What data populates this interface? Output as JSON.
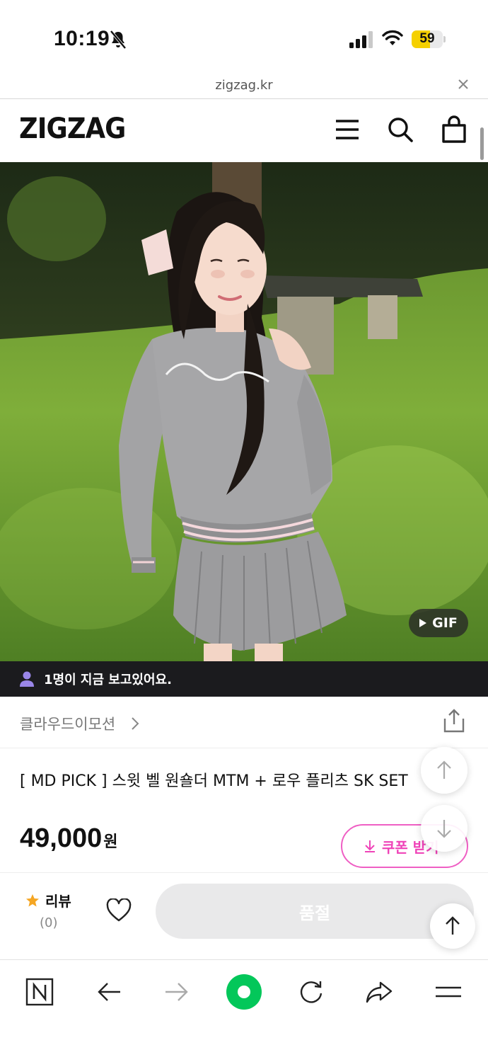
{
  "status_bar": {
    "time": "10:19",
    "battery": "59",
    "battery_fraction": 0.59,
    "icons": [
      "bell-slash-icon",
      "cellular-signal-icon",
      "wifi-icon",
      "battery-icon"
    ]
  },
  "browser_top": {
    "url": "zigzag.kr",
    "close_icon": "close-icon"
  },
  "header": {
    "logo": "ZIGZAG",
    "icons": [
      "menu-icon",
      "search-icon",
      "shopping-bag-icon"
    ]
  },
  "hero": {
    "badge_label": "GIF",
    "badge_icon": "play-icon"
  },
  "viewers_banner": {
    "text": "1명이 지금 보고있어요.",
    "icon": "person-icon"
  },
  "shop": {
    "name": "클라우드이모션",
    "icons": [
      "chevron-right-icon",
      "share-icon"
    ]
  },
  "product": {
    "title": "[ MD PICK ] 스윗 벨 원숄더 MTM + 로우 플리츠 SK SET",
    "price_number": "49,000",
    "price_unit": "원",
    "coupon_label": "쿠폰 받기"
  },
  "action_bar": {
    "review_label": "리뷰",
    "review_count": "(0)",
    "buy_label": "품절"
  },
  "colors": {
    "accent_pink": "#ef43b8",
    "banner_dark": "#1b1b1e",
    "soldout_gray": "#e9e9ea",
    "naver_green": "#03c75a",
    "star_orange": "#f5a623",
    "battery_yellow": "#f5d000"
  },
  "bottom_bar": {
    "icons": [
      "naver-home-icon",
      "back-arrow-icon",
      "forward-arrow-icon",
      "green-dot-icon",
      "reload-icon",
      "share-forward-icon",
      "menu-lines-icon"
    ]
  }
}
